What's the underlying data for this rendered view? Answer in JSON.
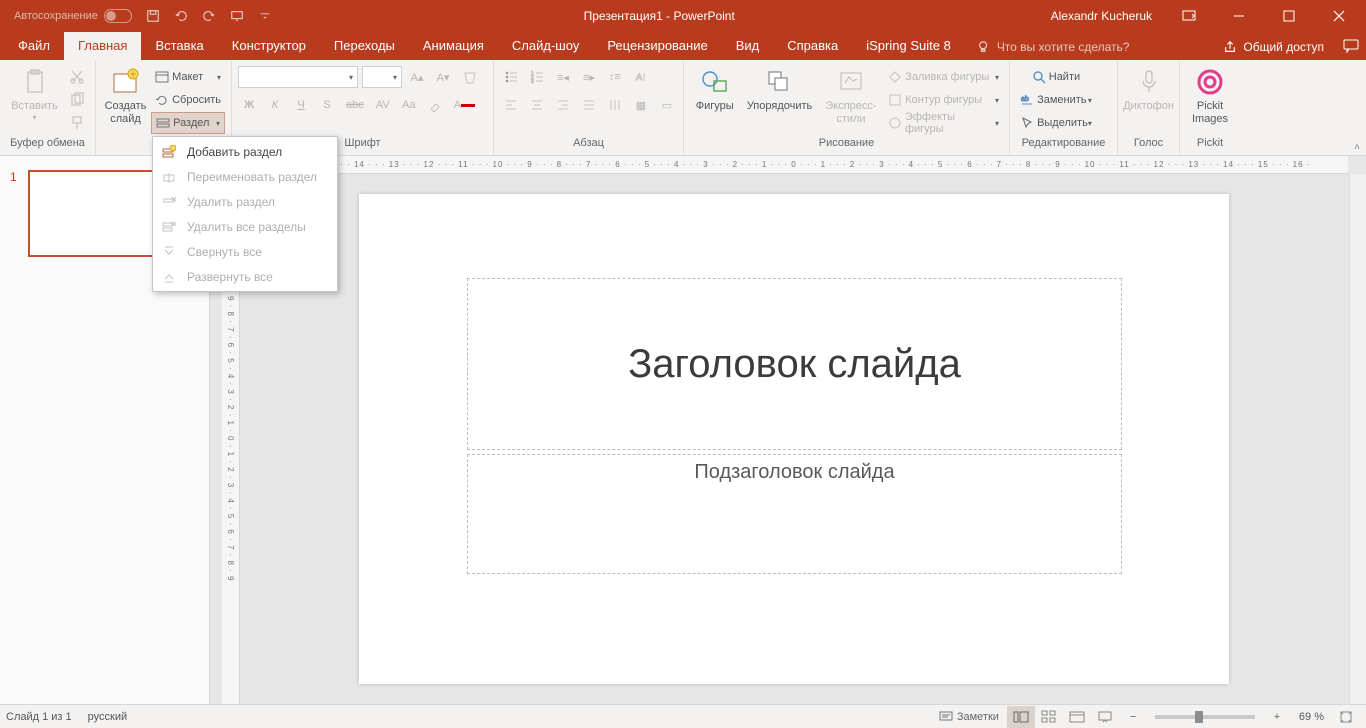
{
  "titlebar": {
    "autosave": "Автосохранение",
    "doc_title": "Презентация1  -  PowerPoint",
    "user": "Alexandr Kucheruk"
  },
  "tabs": {
    "file": "Файл",
    "home": "Главная",
    "insert": "Вставка",
    "design": "Конструктор",
    "transitions": "Переходы",
    "animations": "Анимация",
    "slideshow": "Слайд-шоу",
    "review": "Рецензирование",
    "view": "Вид",
    "help": "Справка",
    "ispring": "iSpring Suite 8",
    "tellme": "Что вы хотите сделать?",
    "share": "Общий доступ"
  },
  "ribbon": {
    "clipboard": {
      "label": "Буфер обмена",
      "paste": "Вставить"
    },
    "slides": {
      "newslide": "Создать\nслайд",
      "layout": "Макет",
      "reset": "Сбросить",
      "section": "Раздел"
    },
    "font": {
      "label": "Шрифт",
      "bold": "Ж",
      "italic": "К",
      "underline": "Ч",
      "shadow": "S",
      "strike": "abc",
      "spacing": "AV",
      "case": "Aa",
      "color": "A"
    },
    "paragraph": {
      "label": "Абзац"
    },
    "drawing": {
      "label": "Рисование",
      "shapes": "Фигуры",
      "arrange": "Упорядочить",
      "quick": "Экспресс-\nстили",
      "fill": "Заливка фигуры",
      "outline": "Контур фигуры",
      "effects": "Эффекты фигуры"
    },
    "editing": {
      "label": "Редактирование",
      "find": "Найти",
      "replace": "Заменить",
      "select": "Выделить"
    },
    "voice": {
      "label": "Голос",
      "dictate": "Диктофон"
    },
    "pickit": {
      "label": "Pickit",
      "btn": "Pickit\nImages"
    }
  },
  "section_menu": {
    "add": "Добавить раздел",
    "rename": "Переименовать раздел",
    "delete": "Удалить раздел",
    "delete_all": "Удалить все разделы",
    "collapse": "Свернуть все",
    "expand": "Развернуть все"
  },
  "slide": {
    "title_ph": "Заголовок слайда",
    "subtitle_ph": "Подзаголовок слайда",
    "thumb_num": "1"
  },
  "ruler": {
    "h": "· 16 · · · 15 · · · 14 · · · 13 · · · 12 · · · 11 · · · 10 · · · 9 · · · 8 · · · 7 · · · 6 · · · 5 · · · 4 · · · 3 · · · 2 · · · 1 · · · 0 · · · 1 · · · 2 · · · 3 · · · 4 · · · 5 · · · 6 · · · 7 · · · 8 · · · 9 · · · 10 · · · 11 · · · 12 · · · 13 · · · 14 · · · 15 · · · 16 ·",
    "v": "9 · 8 · 7 · 6 · 5 · 4 · 3 · 2 · 1 · 0 · 1 · 2 · 3 · 4 · 5 · 6 · 7 · 8 · 9"
  },
  "status": {
    "slide": "Слайд 1 из 1",
    "lang": "русский",
    "notes": "Заметки",
    "zoom": "69 %"
  }
}
